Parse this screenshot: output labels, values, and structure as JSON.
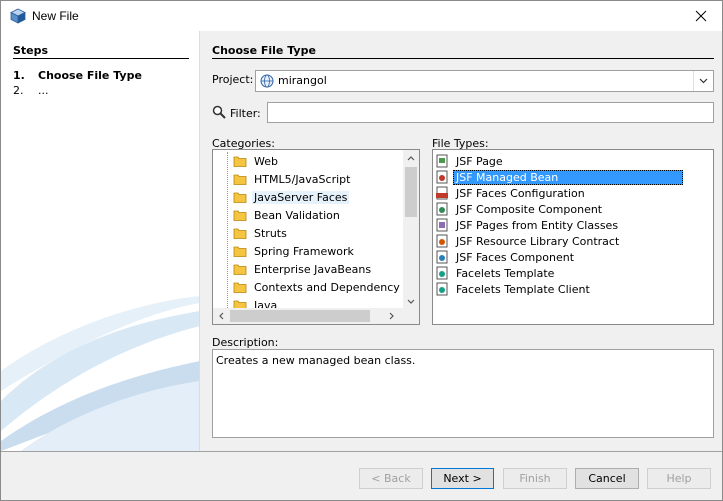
{
  "window": {
    "title": "New File"
  },
  "steps": {
    "heading": "Steps",
    "items": [
      {
        "num": "1.",
        "label": "Choose File Type"
      },
      {
        "num": "2.",
        "label": "..."
      }
    ]
  },
  "main": {
    "heading": "Choose File Type",
    "project_label": "Project:",
    "project_value": "mirangol",
    "filter_label": "Filter:",
    "filter_value": "",
    "categories_label": "Categories:",
    "file_types_label": "File Types:",
    "categories": [
      "Web",
      "HTML5/JavaScript",
      "JavaServer Faces",
      "Bean Validation",
      "Struts",
      "Spring Framework",
      "Enterprise JavaBeans",
      "Contexts and Dependency Inje",
      "Java"
    ],
    "selected_category": "JavaServer Faces",
    "file_types": [
      "JSF Page",
      "JSF Managed Bean",
      "JSF Faces Configuration",
      "JSF Composite Component",
      "JSF Pages from Entity Classes",
      "JSF Resource Library Contract",
      "JSF Faces Component",
      "Facelets Template",
      "Facelets Template Client"
    ],
    "selected_file_type": "JSF Managed Bean",
    "description_label": "Description:",
    "description": "Creates a new managed bean class."
  },
  "buttons": {
    "back": "< Back",
    "next": "Next >",
    "finish": "Finish",
    "cancel": "Cancel",
    "help": "Help"
  },
  "colors": {
    "selection": "#3399ff",
    "accent": "#0078d7"
  }
}
